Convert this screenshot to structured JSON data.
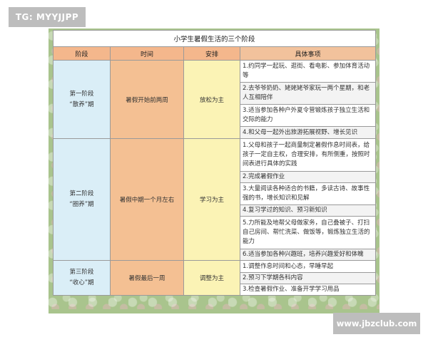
{
  "watermark_top": "TG: MYYJJPP",
  "watermark_bottom": "www.jbzclub.com",
  "table": {
    "title": "小学生暑假生活的三个阶段",
    "headers": {
      "stage": "阶段",
      "time": "时间",
      "focus": "安排",
      "details": "具体事项"
    },
    "stages": [
      {
        "stage_line1": "第一阶段",
        "stage_line2": "“散养”期",
        "time": "暑假开始前两周",
        "focus": "放松为主",
        "items": [
          "1.约同学一起玩、逛街、看电影、参加体育活动等",
          "2.去爷爷奶奶、姥姥姥爷家玩一两个星期，和老人互相陪伴",
          "3.适当参加各种户外夏令营锻炼孩子独立生活和交际的能力",
          "4.和父母一起外出旅游拓展视野、增长见识"
        ]
      },
      {
        "stage_line1": "第二阶段",
        "stage_line2": "“圈养”期",
        "time": "暑假中期一个月左右",
        "focus": "学习为主",
        "items": [
          "1.父母和孩子一起商量制定暑假作息时间表，给孩子一定自主权，合理安排，有所侧重，按照时间表进行具体的实践",
          "2.完成暑假作业",
          "3.大量阅读各种适合的书籍，多读古诗、故事性强的书，增长知识和见解",
          "4.复习学过的知识、预习新知识",
          "5.力所能及地帮父母做家务，自己叠被子、打扫自己房间、帮忙洗菜、做饭等，锻炼独立生活的能力",
          "6.适当参加各种兴趣班，培养兴趣爱好和体魄"
        ]
      },
      {
        "stage_line1": "第三阶段",
        "stage_line2": "“收心”期",
        "time": "暑假最后一周",
        "focus": "调整为主",
        "items": [
          "1.调整作息时间和心态，早睡早起",
          "2.预习下学期各科内容",
          "3.检查暑假作业、准备开学学习用品"
        ]
      }
    ]
  }
}
